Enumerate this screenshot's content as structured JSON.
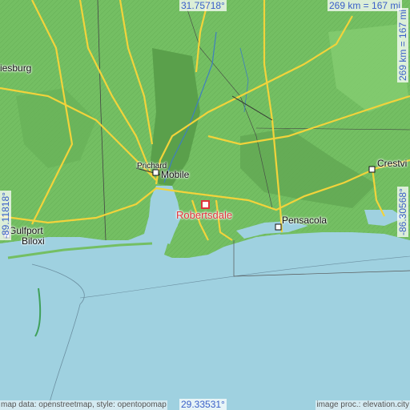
{
  "map": {
    "coords": {
      "top": "31.75718°",
      "bottom": "29.33531°",
      "left": "-89.11818°",
      "right": "-86.30568°"
    },
    "scale": {
      "horizontal": "269 km = 167 mi",
      "vertical": "269 km = 167 mi"
    },
    "focus_city": "Robertsdale",
    "cities": {
      "hattiesburg": "iesburg",
      "prichard": "Prichard",
      "mobile": "Mobile",
      "gulfport": "Gulfport",
      "biloxi": "Biloxi",
      "pensacola": "Pensacola",
      "crestview": "Crestvi"
    },
    "credits": {
      "left": "map data: openstreetmap, style: opentopomap",
      "right": "image proc.: elevation.city"
    },
    "colors": {
      "water": "#9fd1e0",
      "lowland": "#5fa84f",
      "upland": "#7cc86a",
      "road": "#f2d33b",
      "focus": "#e0333a",
      "coord_text": "#3a5fc8"
    }
  }
}
